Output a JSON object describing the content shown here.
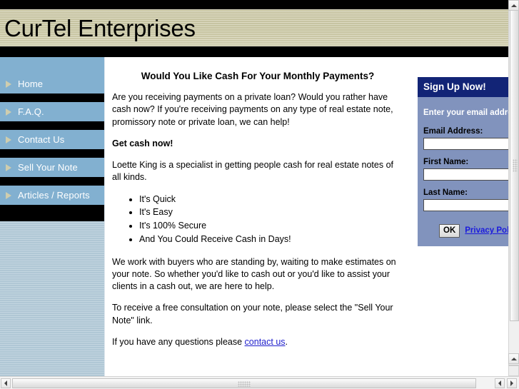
{
  "site": {
    "title": "CurTel Enterprises"
  },
  "sidebar": {
    "items": [
      {
        "label": "Home"
      },
      {
        "label": "F.A.Q."
      },
      {
        "label": "Contact Us"
      },
      {
        "label": "Sell Your Note"
      },
      {
        "label": "Articles / Reports"
      }
    ]
  },
  "main": {
    "heading": "Would You Like Cash For Your Monthly Payments?",
    "paragraph1": "Are you receiving payments on a private loan? Would you rather have cash now? If you're receiving payments on any type of real estate note, promissory note or private loan, we can help!",
    "callout": "Get cash now!",
    "paragraph2": "Loette King is a specialist in getting people cash for real estate notes of all kinds.",
    "benefits": [
      "It's Quick",
      "It's Easy",
      "It's 100% Secure",
      "And You Could Receive Cash in Days!"
    ],
    "paragraph3": "We work with buyers who are standing by, waiting to make estimates on your note. So whether you'd like to cash out or you'd like to assist your clients in a cash out, we are here to help.",
    "paragraph4": "To receive a free consultation on your note, please select the \"Sell Your Note\" link.",
    "paragraph5_prefix": "If you have any questions please ",
    "paragraph5_link": "contact us",
    "paragraph5_suffix": "."
  },
  "signup": {
    "header": "Sign Up Now!",
    "intro": "Enter your email address for free articles and information:",
    "email_label": "Email Address:",
    "email_value": "",
    "first_name_label": "First Name:",
    "first_name_value": "",
    "last_name_label": "Last Name:",
    "last_name_value": "",
    "ok_label": "OK",
    "privacy_label": "Privacy Policy"
  },
  "colors": {
    "header_beige": "#cdcaa6",
    "nav_blue": "#82b0d0",
    "sidebar_blue": "#b3cbd9",
    "signup_panel": "#8193bd",
    "signup_header": "#122476",
    "link_blue": "#2020cc"
  }
}
